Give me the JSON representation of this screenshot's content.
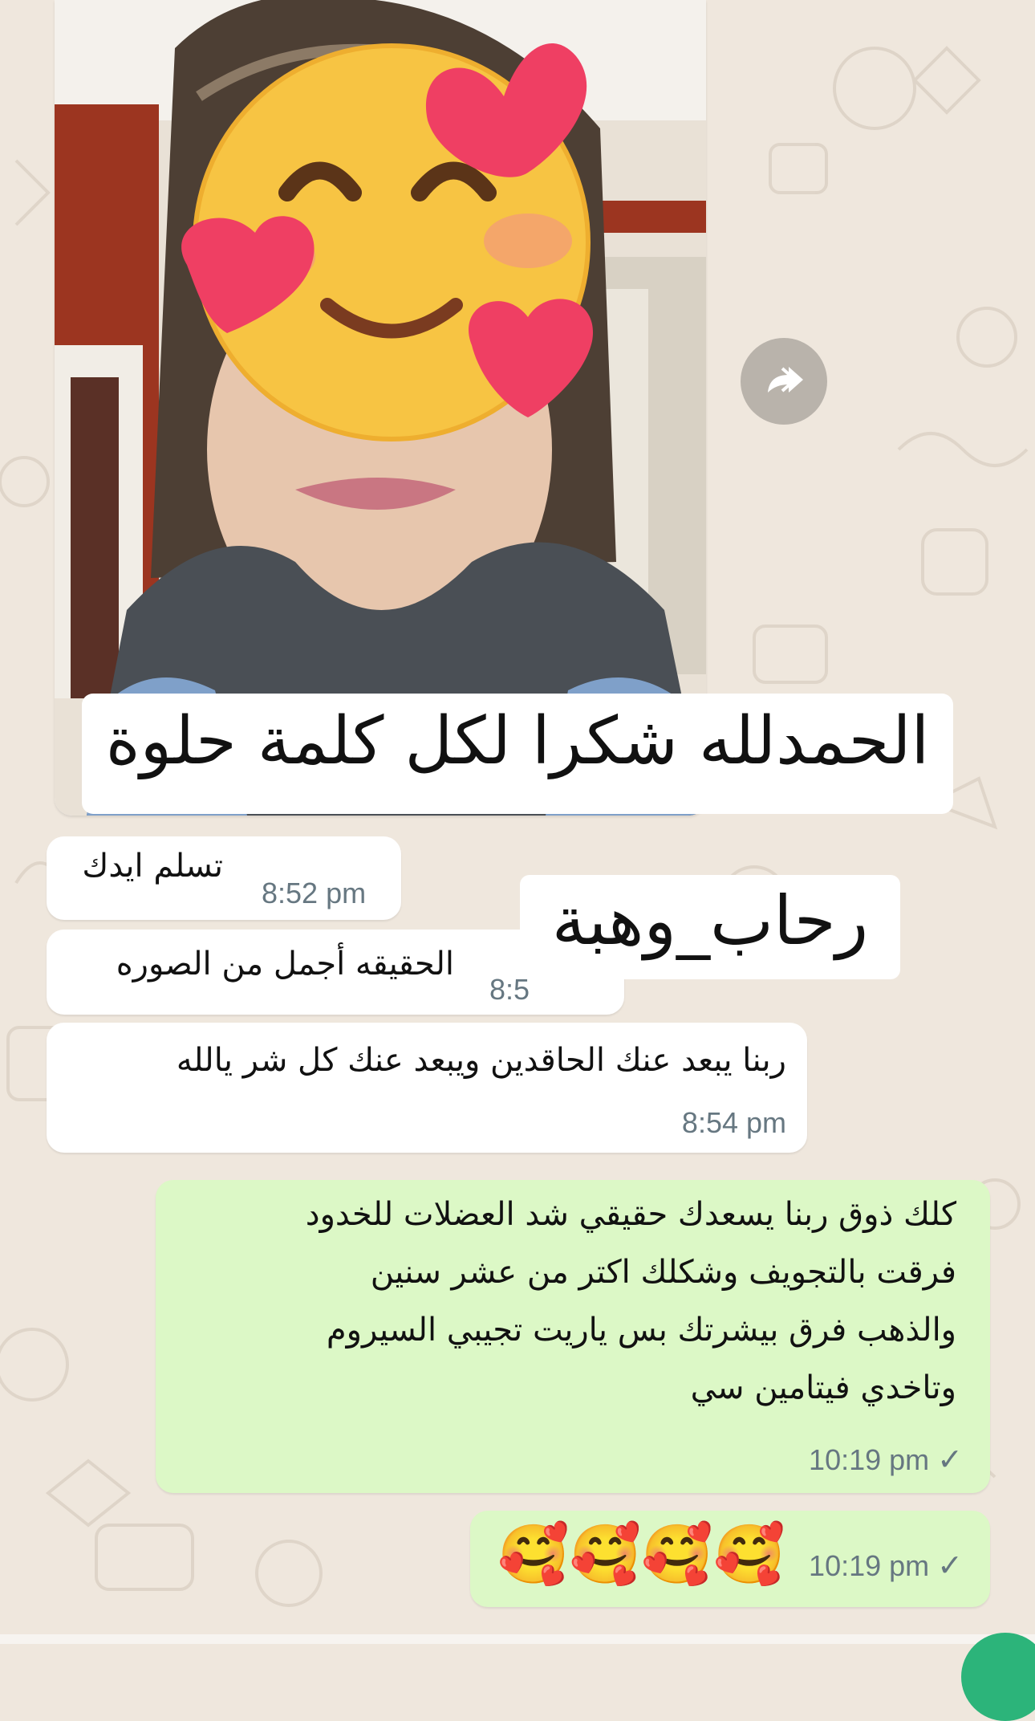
{
  "colors": {
    "wallpaper": "#efe7dd",
    "incoming_bubble": "#ffffff",
    "outgoing_bubble": "#dcf8c6",
    "timestamp": "#667781",
    "fab": "#2cb47a"
  },
  "photo_message": {
    "caption": "الحمدلله شكرا لكل كلمة حلوة",
    "forward_icon": "forward-icon"
  },
  "signature": "رحاب_وهبة",
  "messages": [
    {
      "direction": "in",
      "text": "تسلم ايدك",
      "time": "8:52 pm"
    },
    {
      "direction": "in",
      "text": "الحقيقه أجمل من الصوره",
      "time": "8:5"
    },
    {
      "direction": "in",
      "text": "ربنا يبعد عنك الحاقدين ويبعد عنك كل شر يالله",
      "time": "8:54 pm"
    },
    {
      "direction": "out",
      "lines": [
        "كلك ذوق ربنا يسعدك حقيقي شد العضلات للخدود",
        "فرقت بالتجويف وشكلك اكتر من عشر سنين",
        "والذهب فرق بيشرتك بس ياريت تجيبي السيروم",
        "وتاخدي فيتامين سي"
      ],
      "time": "10:19 pm",
      "status_icon": "single-check-icon"
    },
    {
      "direction": "out",
      "emoji": "🥰🥰🥰🥰",
      "time": "10:19 pm",
      "status_icon": "single-check-icon"
    }
  ]
}
